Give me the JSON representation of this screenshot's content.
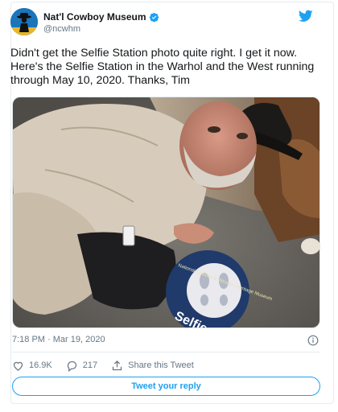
{
  "author": {
    "display_name": "Nat'l Cowboy Museum",
    "handle": "@ncwhm",
    "verified": true
  },
  "tweet": {
    "text": "Didn't get the Selfie Station photo quite right. I get it now. Here's the Selfie Station in the Warhol and the West running through May 10, 2020. Thanks, Tim"
  },
  "media": {
    "floor_decal_text": "Selfie Sta",
    "floor_decal_ring_text": "National Cowboy & Western Heritage Museum"
  },
  "meta": {
    "timestamp": "7:18 PM · Mar 19, 2020"
  },
  "actions": {
    "likes": "16.9K",
    "replies": "217",
    "share_label": "Share this Tweet"
  },
  "reply_button": {
    "label": "Tweet your reply"
  },
  "colors": {
    "accent": "#1da1f2",
    "text": "#14171a",
    "muted": "#657786"
  }
}
